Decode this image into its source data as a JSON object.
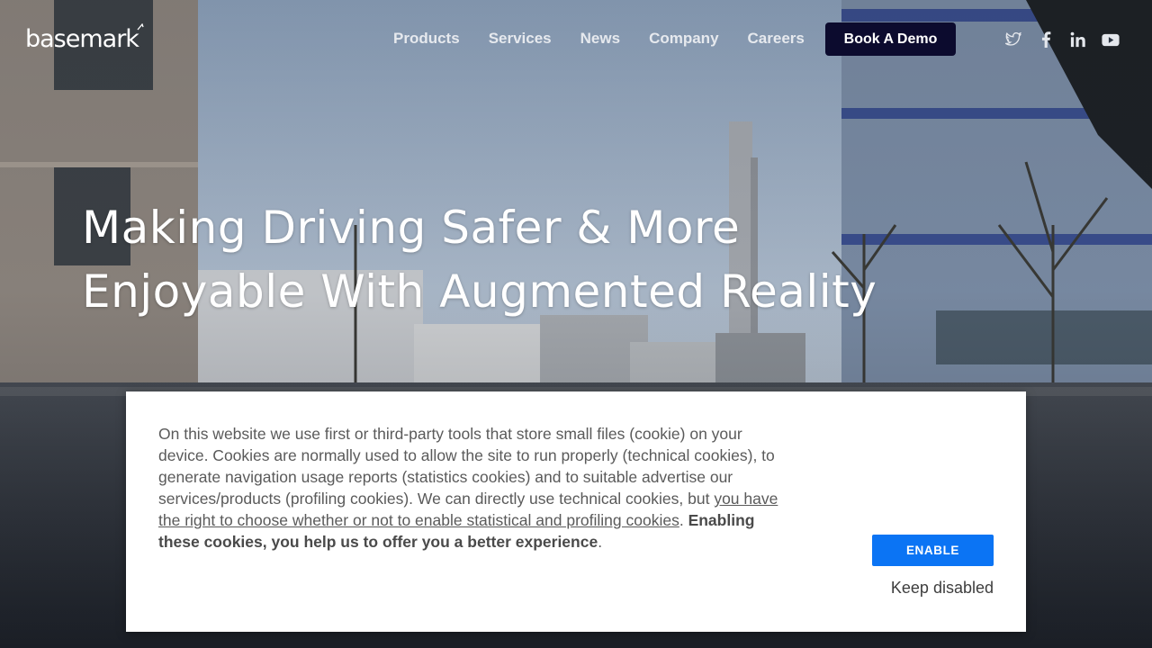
{
  "brand": {
    "logo_text": "basemark",
    "logo_icon": "basemark-logo"
  },
  "nav": {
    "items": [
      {
        "label": "Products"
      },
      {
        "label": "Services"
      },
      {
        "label": "News"
      },
      {
        "label": "Company"
      },
      {
        "label": "Careers"
      }
    ],
    "cta_label": "Book A Demo",
    "social_icons": [
      "twitter-icon",
      "facebook-icon",
      "linkedin-icon",
      "youtube-icon"
    ]
  },
  "hero": {
    "title_line1": "Making Driving Safer & More",
    "title_line2": "Enjoyable With Augmented Reality"
  },
  "cookie_banner": {
    "text_intro": "On this website we use first or third-party tools that store small files (cookie) on your device. Cookies are normally used to allow the site to run properly (technical cookies), to generate navigation usage reports (statistics cookies) and to suitable advertise our services/products (profiling cookies). We can directly use technical cookies, but ",
    "link_text": "you have the right to choose whether or not to enable statistical and profiling cookies",
    "text_after_link": ". ",
    "bold_text": "Enabling these cookies, you help us to offer you a better experience",
    "text_end": ".",
    "enable_label": "ENABLE",
    "keep_disabled_label": "Keep disabled"
  },
  "colors": {
    "demo_button_bg": "#0c0b2e",
    "enable_button_bg": "#0b74f4",
    "banner_bg": "#ffffff"
  }
}
